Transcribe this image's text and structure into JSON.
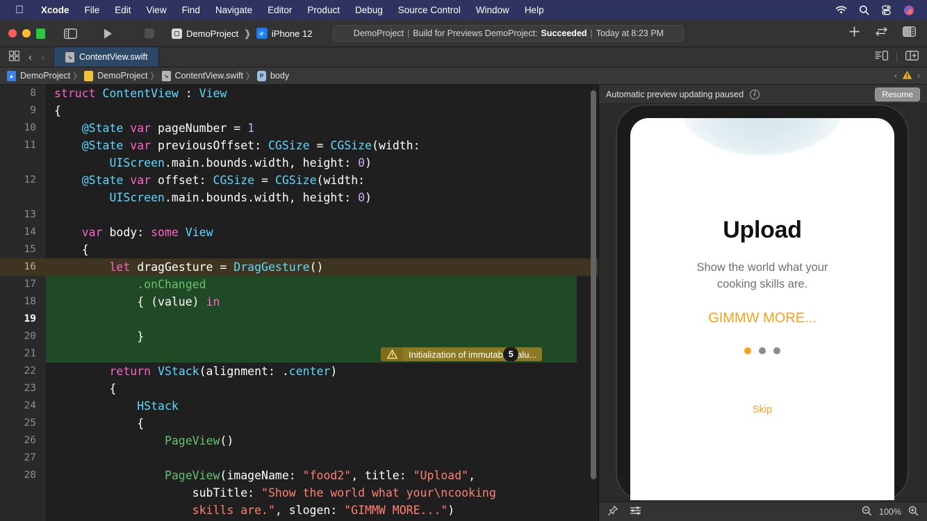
{
  "menubar": {
    "apple_icon": "apple-logo-icon",
    "items": [
      {
        "label": "Xcode",
        "bold": true
      },
      {
        "label": "File"
      },
      {
        "label": "Edit"
      },
      {
        "label": "View"
      },
      {
        "label": "Find"
      },
      {
        "label": "Navigate"
      },
      {
        "label": "Editor"
      },
      {
        "label": "Product"
      },
      {
        "label": "Debug"
      },
      {
        "label": "Source Control"
      },
      {
        "label": "Window"
      },
      {
        "label": "Help"
      }
    ],
    "status_icons": [
      "wifi-icon",
      "search-icon",
      "control-center-icon",
      "siri-icon"
    ],
    "background": "#2e3360"
  },
  "toolbar": {
    "window_controls": [
      "close-button",
      "minimize-button",
      "maximize-button"
    ],
    "sidebar_toggle": "sidebar-toggle-icon",
    "run_button": "run-icon",
    "stop_button": "stop-icon",
    "scheme_name": "DemoProject",
    "destination_name": "iPhone 12",
    "build_status": {
      "project": "DemoProject",
      "action": "Build for Previews DemoProject:",
      "result": "Succeeded",
      "time": "Today at 8:23 PM"
    },
    "right_icons": [
      "add-icon",
      "swap-editors-icon",
      "inspector-toggle-icon"
    ]
  },
  "tabbar": {
    "left_icons": [
      "grid-view-icon",
      "back-chevron-icon",
      "forward-chevron-icon"
    ],
    "tab": {
      "label": "ContentView.swift",
      "icon": "swift-file-icon"
    },
    "right_icons": [
      "minimap-toggle-icon",
      "add-editor-icon"
    ]
  },
  "breadcrumb": {
    "items": [
      {
        "label": "DemoProject",
        "icon": "project-icon"
      },
      {
        "label": "DemoProject",
        "icon": "folder-icon"
      },
      {
        "label": "ContentView.swift",
        "icon": "swift-file-icon"
      },
      {
        "label": "body",
        "icon": "property-symbol-icon"
      }
    ],
    "separator": "〉",
    "nav": {
      "prev": "‹",
      "warning_icon": "warning-triangle-icon",
      "next": "›"
    }
  },
  "editor": {
    "warning": {
      "icon": "warning-triangle-icon",
      "text": "Initialization of immutable valu...",
      "count": "5"
    },
    "lines": [
      {
        "n": "8",
        "tokens": [
          {
            "t": "struct ",
            "c": "kw"
          },
          {
            "t": "ContentView ",
            "c": "type"
          },
          {
            "t": ": ",
            "c": "plain"
          },
          {
            "t": "View",
            "c": "type"
          }
        ],
        "indent": 0
      },
      {
        "n": "9",
        "tokens": [
          {
            "t": "{",
            "c": "plain"
          }
        ],
        "indent": 0
      },
      {
        "n": "10",
        "tokens": [
          {
            "t": "    @State ",
            "c": "type"
          },
          {
            "t": "var ",
            "c": "kw"
          },
          {
            "t": "pageNumber = ",
            "c": "plain"
          },
          {
            "t": "1",
            "c": "num"
          }
        ],
        "indent": 0
      },
      {
        "n": "11",
        "tokens": [
          {
            "t": "    @State ",
            "c": "type"
          },
          {
            "t": "var ",
            "c": "kw"
          },
          {
            "t": "previousOffset: ",
            "c": "plain"
          },
          {
            "t": "CGSize",
            "c": "type"
          },
          {
            "t": " = ",
            "c": "plain"
          },
          {
            "t": "CGSize",
            "c": "type"
          },
          {
            "t": "(width:",
            "c": "plain"
          }
        ],
        "indent": 0
      },
      {
        "n": "",
        "tokens": [
          {
            "t": "        UIScreen",
            "c": "type"
          },
          {
            "t": ".main.bounds.width, height: ",
            "c": "plain"
          },
          {
            "t": "0",
            "c": "num"
          },
          {
            "t": ")",
            "c": "plain"
          }
        ],
        "indent": 0
      },
      {
        "n": "12",
        "tokens": [
          {
            "t": "    @State ",
            "c": "type"
          },
          {
            "t": "var ",
            "c": "kw"
          },
          {
            "t": "offset: ",
            "c": "plain"
          },
          {
            "t": "CGSize",
            "c": "type"
          },
          {
            "t": " = ",
            "c": "plain"
          },
          {
            "t": "CGSize",
            "c": "type"
          },
          {
            "t": "(width:",
            "c": "plain"
          }
        ],
        "indent": 0
      },
      {
        "n": "",
        "tokens": [
          {
            "t": "        UIScreen",
            "c": "type"
          },
          {
            "t": ".main.bounds.width, height: ",
            "c": "plain"
          },
          {
            "t": "0",
            "c": "num"
          },
          {
            "t": ")",
            "c": "plain"
          }
        ],
        "indent": 0
      },
      {
        "n": "13",
        "tokens": [],
        "indent": 0
      },
      {
        "n": "14",
        "tokens": [
          {
            "t": "    var ",
            "c": "kw"
          },
          {
            "t": "body: ",
            "c": "plain"
          },
          {
            "t": "some ",
            "c": "kw"
          },
          {
            "t": "View",
            "c": "type"
          }
        ],
        "indent": 0
      },
      {
        "n": "15",
        "tokens": [
          {
            "t": "    {",
            "c": "plain"
          }
        ],
        "indent": 0
      },
      {
        "n": "16",
        "tokens": [
          {
            "t": "        let ",
            "c": "kw"
          },
          {
            "t": "dragGesture = ",
            "c": "plain"
          },
          {
            "t": "DragGesture",
            "c": "type"
          },
          {
            "t": "()",
            "c": "plain"
          }
        ],
        "indent": 0,
        "warn": true
      },
      {
        "n": "17",
        "tokens": [
          {
            "t": "            .onChanged",
            "c": "fn"
          }
        ],
        "indent": 0,
        "green": true
      },
      {
        "n": "18",
        "tokens": [
          {
            "t": "            { (value) ",
            "c": "plain"
          },
          {
            "t": "in",
            "c": "kw"
          }
        ],
        "indent": 0,
        "green": true
      },
      {
        "n": "19",
        "tokens": [],
        "indent": 0,
        "green": true,
        "current": true
      },
      {
        "n": "20",
        "tokens": [
          {
            "t": "            }",
            "c": "plain"
          }
        ],
        "indent": 0,
        "green": true
      },
      {
        "n": "21",
        "tokens": [],
        "indent": 0
      },
      {
        "n": "22",
        "tokens": [
          {
            "t": "        return ",
            "c": "kw"
          },
          {
            "t": "VStack",
            "c": "type"
          },
          {
            "t": "(alignment: .",
            "c": "plain"
          },
          {
            "t": "center",
            "c": "type"
          },
          {
            "t": ")",
            "c": "plain"
          }
        ],
        "indent": 0
      },
      {
        "n": "23",
        "tokens": [
          {
            "t": "        {",
            "c": "plain"
          }
        ],
        "indent": 0
      },
      {
        "n": "24",
        "tokens": [
          {
            "t": "            HStack",
            "c": "type"
          }
        ],
        "indent": 0
      },
      {
        "n": "25",
        "tokens": [
          {
            "t": "            {",
            "c": "plain"
          }
        ],
        "indent": 0
      },
      {
        "n": "26",
        "tokens": [
          {
            "t": "                PageView",
            "c": "fn"
          },
          {
            "t": "()",
            "c": "plain"
          }
        ],
        "indent": 0
      },
      {
        "n": "27",
        "tokens": [],
        "indent": 0
      },
      {
        "n": "28",
        "tokens": [
          {
            "t": "                PageView",
            "c": "fn"
          },
          {
            "t": "(imageName: ",
            "c": "plain"
          },
          {
            "t": "\"food2\"",
            "c": "str"
          },
          {
            "t": ", title: ",
            "c": "plain"
          },
          {
            "t": "\"Upload\"",
            "c": "str"
          },
          {
            "t": ",",
            "c": "plain"
          }
        ],
        "indent": 0
      },
      {
        "n": "",
        "tokens": [
          {
            "t": "                    subTitle: ",
            "c": "plain"
          },
          {
            "t": "\"Show the world what your\\ncooking",
            "c": "str"
          }
        ],
        "indent": 0
      },
      {
        "n": "",
        "tokens": [
          {
            "t": "                    skills are.\"",
            "c": "str"
          },
          {
            "t": ", slogen: ",
            "c": "plain"
          },
          {
            "t": "\"GIMMW MORE...\"",
            "c": "str"
          },
          {
            "t": ")",
            "c": "plain"
          }
        ],
        "indent": 0
      }
    ]
  },
  "preview": {
    "header": {
      "message": "Automatic preview updating paused",
      "info_icon": "info-circle-icon",
      "resume_label": "Resume"
    },
    "device": {
      "title": "Upload",
      "subtitle": "Show the world what your\ncooking skills are.",
      "slogan": "GIMMW MORE...",
      "skip_label": "Skip",
      "page_dots": {
        "total": 3,
        "active_index": 0
      }
    },
    "footer": {
      "pin_icon": "pin-icon",
      "settings_icon": "sliders-icon",
      "zoom_out_icon": "zoom-out-icon",
      "zoom_level": "100%",
      "zoom_in_icon": "zoom-in-icon"
    }
  },
  "colors": {
    "accent_orange": "#f5a01e",
    "menubar_blue": "#2e3360",
    "warning_amber": "#8b7a22",
    "diff_green": "#1f4a25",
    "tab_active_blue": "#2d4766"
  }
}
